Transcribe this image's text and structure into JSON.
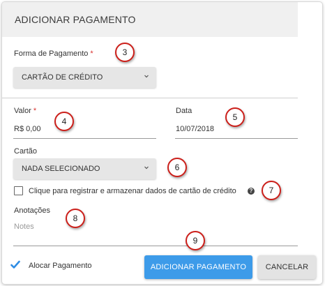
{
  "dialog": {
    "title": "ADICIONAR PAGAMENTO"
  },
  "payment_method": {
    "label": "Forma de Pagamento",
    "required_marker": "*",
    "selected": "CARTÃO DE CRÉDITO"
  },
  "value": {
    "label": "Valor",
    "required_marker": "*",
    "value": "R$ 0,00"
  },
  "date": {
    "label": "Data",
    "value": "10/07/2018"
  },
  "card": {
    "label": "Cartão",
    "selected": "NADA SELECIONADO"
  },
  "save_card": {
    "label": "Clique para registrar e armazenar dados de cartão de crédito",
    "help_glyph": "?"
  },
  "notes": {
    "label": "Anotações",
    "placeholder": "Notes"
  },
  "allocate": {
    "label": "Alocar Pagamento",
    "color": "#2f8de4"
  },
  "actions": {
    "add_label": "ADICIONAR PAGAMENTO",
    "cancel_label": "CANCELAR",
    "primary_color": "#3d9be9"
  },
  "callouts": [
    "3",
    "4",
    "5",
    "6",
    "7",
    "8",
    "9"
  ]
}
